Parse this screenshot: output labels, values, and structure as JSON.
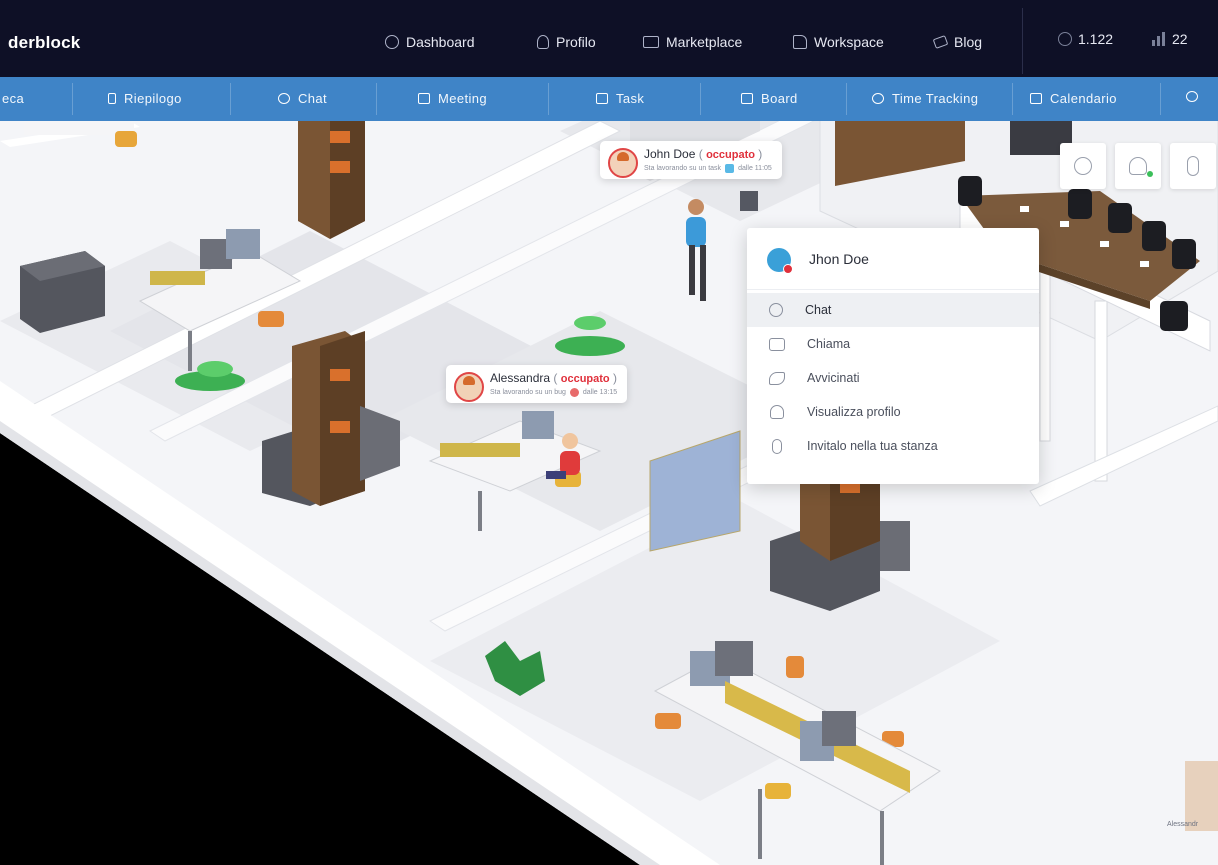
{
  "app": {
    "brand": "derblock"
  },
  "topnav": {
    "items": [
      {
        "label": "Dashboard",
        "icon": "dashboard-icon"
      },
      {
        "label": "Profilo",
        "icon": "user-icon"
      },
      {
        "label": "Marketplace",
        "icon": "briefcase-icon"
      },
      {
        "label": "Workspace",
        "icon": "workspace-icon"
      },
      {
        "label": "Blog",
        "icon": "megaphone-icon"
      }
    ],
    "stats": [
      {
        "value": "1.122",
        "icon": "coins-icon"
      },
      {
        "value": "22",
        "icon": "bar-chart-icon"
      }
    ]
  },
  "subnav": {
    "items": [
      {
        "label": "eca",
        "icon": "library-icon"
      },
      {
        "label": "Riepilogo",
        "icon": "summary-icon"
      },
      {
        "label": "Chat",
        "icon": "chat-icon"
      },
      {
        "label": "Meeting",
        "icon": "video-icon"
      },
      {
        "label": "Task",
        "icon": "task-list-icon"
      },
      {
        "label": "Board",
        "icon": "board-icon"
      },
      {
        "label": "Time Tracking",
        "icon": "clock-icon"
      },
      {
        "label": "Calendario",
        "icon": "calendar-icon"
      }
    ]
  },
  "presence": [
    {
      "name": "John Doe",
      "status": "occupato",
      "activity": "Sta lavorando su un task",
      "since": "dalle 11:05"
    },
    {
      "name": "Alessandra",
      "status": "occupato",
      "activity": "Sta lavorando su un bug",
      "since": "dalle 13:15"
    }
  ],
  "context_menu": {
    "user_name": "Jhon Doe",
    "items": [
      {
        "label": "Chat",
        "icon": "chat-icon",
        "active": true
      },
      {
        "label": "Chiama",
        "icon": "video-call-icon",
        "active": false
      },
      {
        "label": "Avvicinati",
        "icon": "walk-icon",
        "active": false
      },
      {
        "label": "Visualizza profilo",
        "icon": "profile-icon",
        "active": false
      },
      {
        "label": "Invitalo nella tua stanza",
        "icon": "microphone-icon",
        "active": false
      }
    ]
  },
  "quick_actions": [
    {
      "icon": "emoji-icon"
    },
    {
      "icon": "user-online-icon"
    },
    {
      "icon": "microphone-icon"
    }
  ],
  "floor_labels": [
    "Alessandr"
  ],
  "colors": {
    "topbar": "#0e1026",
    "subbar": "#3f84c7",
    "busy": "#e0303b",
    "floor": "#f4f5f8"
  }
}
